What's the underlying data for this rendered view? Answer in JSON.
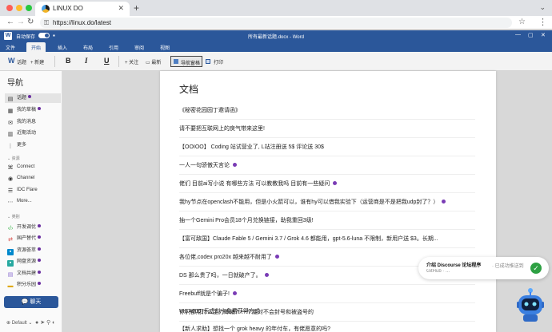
{
  "browser": {
    "tab_title": "LINUX DO",
    "tab_close": "✕",
    "new_tab": "+",
    "url": "https://linux.do/latest",
    "traffic_colors": [
      "#fe5f57",
      "#febc2e",
      "#28c840"
    ]
  },
  "word": {
    "app_letter": "W",
    "autosave_label": "自动保存",
    "document_title": "所有最新话题.docx - Word",
    "tabs": [
      "文件",
      "开始",
      "插入",
      "布局",
      "引用",
      "审阅",
      "视图"
    ],
    "active_tab": "开始",
    "toolbar": {
      "topic": "话题",
      "new": "新建",
      "bold": "B",
      "italic": "I",
      "underline": "U",
      "follow": "关注",
      "latest": "最新",
      "nav_pane": "导航窗格",
      "print": "打印"
    },
    "accent": "#2b579a"
  },
  "nav": {
    "heading": "导航",
    "items": [
      {
        "label": "话题",
        "icon": "topic-icon",
        "active": true,
        "dot": true
      },
      {
        "label": "我的草稿",
        "icon": "draft-icon",
        "active": false,
        "dot": true
      },
      {
        "label": "我的消息",
        "icon": "message-icon",
        "active": false,
        "dot": false
      },
      {
        "label": "近期活动",
        "icon": "activity-icon",
        "active": false,
        "dot": false
      },
      {
        "label": "更多",
        "icon": "more-icon",
        "active": false,
        "dot": false
      }
    ],
    "resources_label": "资源",
    "resources": [
      "Connect",
      "Channel",
      "IDC Flare",
      "More..."
    ],
    "categories_label": "类别",
    "categories": [
      {
        "label": "开发调优",
        "icon": "code-icon",
        "color": "#3ab54a",
        "dot": true
      },
      {
        "label": "国产替代",
        "icon": "swap-icon",
        "color": "#d9534f",
        "dot": true
      },
      {
        "label": "资源荟萃",
        "icon": "folder-icon",
        "color": "#0088cc",
        "dot": true
      },
      {
        "label": "网盘资源",
        "icon": "cloud-icon",
        "color": "#27a9a0",
        "dot": true
      },
      {
        "label": "文档共建",
        "icon": "doc-icon",
        "color": "#8a6fd1",
        "dot": true
      },
      {
        "label": "积分乐园",
        "icon": "coin-icon",
        "color": "#e0a800",
        "dot": true
      }
    ],
    "chat_button": "聊天",
    "footer_theme": "Default"
  },
  "document": {
    "heading": "文档",
    "topics": [
      {
        "title": "《秘密花园园丁邀请函》",
        "dot": false
      },
      {
        "title": "请不要把互联网上的戾气带来这里!",
        "dot": false
      },
      {
        "title": "【OOIOO】 Coding 站试营业了, L站注册送 5$ 评论送 30$",
        "dot": false
      },
      {
        "title": "一人一句骄傲天言论",
        "dot": true
      },
      {
        "title": "佬们 目前ai写小说 有哪些方法 可以教教我吗 目前有一些疑问",
        "dot": true
      },
      {
        "title": "我hy节点在openclash不能用，但是小火箭可以，谁有hy可以借我实验下（运营商是不是把我udp封了？）",
        "dot": true
      },
      {
        "title": "抽一个Gemini Pro会员18个月兑换链接，助我重回3级!",
        "dot": false
      },
      {
        "title": "【富可敌国】Claude Fable 5 / Gemini 3.7 / Grok 4.6 都能用，gpt-5.6-luna 不限制，新用户送 $3。长期...",
        "dot": false
      },
      {
        "title": "各位佬,codex pro20x 越来越不耐用了",
        "dot": true
      },
      {
        "title": "DS 那么贵了吗，一日就破产了。",
        "dot": true
      },
      {
        "title": "Freebuff就是个骗子!",
        "dot": true
      },
      {
        "title": "你们都用什么主力邮箱？一个绝对不会封号和被盗号的",
        "dot": false
      },
      {
        "title": "VISA20刀乐虚拟卡免费获得方式",
        "dot": false
      },
      {
        "title": "【新人求助】想找一个 grok heavy 的年付车，有佬愿意的吗?",
        "dot": false
      }
    ]
  },
  "toast": {
    "title": "介绍 Discourse 论坛程序",
    "extra": "· 已成功推送到",
    "subtitle": "GitHub · ..."
  }
}
